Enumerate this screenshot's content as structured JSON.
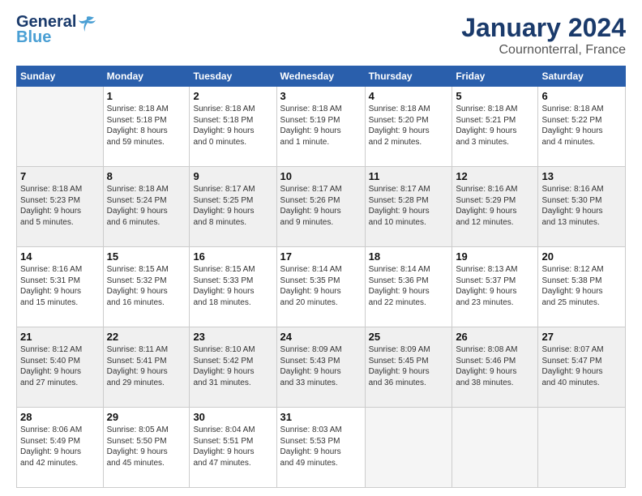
{
  "logo": {
    "text1": "General",
    "text2": "Blue"
  },
  "title": "January 2024",
  "subtitle": "Cournonterral, France",
  "weekdays": [
    "Sunday",
    "Monday",
    "Tuesday",
    "Wednesday",
    "Thursday",
    "Friday",
    "Saturday"
  ],
  "rows": [
    [
      {
        "day": "",
        "info": ""
      },
      {
        "day": "1",
        "info": "Sunrise: 8:18 AM\nSunset: 5:18 PM\nDaylight: 8 hours\nand 59 minutes."
      },
      {
        "day": "2",
        "info": "Sunrise: 8:18 AM\nSunset: 5:18 PM\nDaylight: 9 hours\nand 0 minutes."
      },
      {
        "day": "3",
        "info": "Sunrise: 8:18 AM\nSunset: 5:19 PM\nDaylight: 9 hours\nand 1 minute."
      },
      {
        "day": "4",
        "info": "Sunrise: 8:18 AM\nSunset: 5:20 PM\nDaylight: 9 hours\nand 2 minutes."
      },
      {
        "day": "5",
        "info": "Sunrise: 8:18 AM\nSunset: 5:21 PM\nDaylight: 9 hours\nand 3 minutes."
      },
      {
        "day": "6",
        "info": "Sunrise: 8:18 AM\nSunset: 5:22 PM\nDaylight: 9 hours\nand 4 minutes."
      }
    ],
    [
      {
        "day": "7",
        "info": "Sunrise: 8:18 AM\nSunset: 5:23 PM\nDaylight: 9 hours\nand 5 minutes."
      },
      {
        "day": "8",
        "info": "Sunrise: 8:18 AM\nSunset: 5:24 PM\nDaylight: 9 hours\nand 6 minutes."
      },
      {
        "day": "9",
        "info": "Sunrise: 8:17 AM\nSunset: 5:25 PM\nDaylight: 9 hours\nand 8 minutes."
      },
      {
        "day": "10",
        "info": "Sunrise: 8:17 AM\nSunset: 5:26 PM\nDaylight: 9 hours\nand 9 minutes."
      },
      {
        "day": "11",
        "info": "Sunrise: 8:17 AM\nSunset: 5:28 PM\nDaylight: 9 hours\nand 10 minutes."
      },
      {
        "day": "12",
        "info": "Sunrise: 8:16 AM\nSunset: 5:29 PM\nDaylight: 9 hours\nand 12 minutes."
      },
      {
        "day": "13",
        "info": "Sunrise: 8:16 AM\nSunset: 5:30 PM\nDaylight: 9 hours\nand 13 minutes."
      }
    ],
    [
      {
        "day": "14",
        "info": "Sunrise: 8:16 AM\nSunset: 5:31 PM\nDaylight: 9 hours\nand 15 minutes."
      },
      {
        "day": "15",
        "info": "Sunrise: 8:15 AM\nSunset: 5:32 PM\nDaylight: 9 hours\nand 16 minutes."
      },
      {
        "day": "16",
        "info": "Sunrise: 8:15 AM\nSunset: 5:33 PM\nDaylight: 9 hours\nand 18 minutes."
      },
      {
        "day": "17",
        "info": "Sunrise: 8:14 AM\nSunset: 5:35 PM\nDaylight: 9 hours\nand 20 minutes."
      },
      {
        "day": "18",
        "info": "Sunrise: 8:14 AM\nSunset: 5:36 PM\nDaylight: 9 hours\nand 22 minutes."
      },
      {
        "day": "19",
        "info": "Sunrise: 8:13 AM\nSunset: 5:37 PM\nDaylight: 9 hours\nand 23 minutes."
      },
      {
        "day": "20",
        "info": "Sunrise: 8:12 AM\nSunset: 5:38 PM\nDaylight: 9 hours\nand 25 minutes."
      }
    ],
    [
      {
        "day": "21",
        "info": "Sunrise: 8:12 AM\nSunset: 5:40 PM\nDaylight: 9 hours\nand 27 minutes."
      },
      {
        "day": "22",
        "info": "Sunrise: 8:11 AM\nSunset: 5:41 PM\nDaylight: 9 hours\nand 29 minutes."
      },
      {
        "day": "23",
        "info": "Sunrise: 8:10 AM\nSunset: 5:42 PM\nDaylight: 9 hours\nand 31 minutes."
      },
      {
        "day": "24",
        "info": "Sunrise: 8:09 AM\nSunset: 5:43 PM\nDaylight: 9 hours\nand 33 minutes."
      },
      {
        "day": "25",
        "info": "Sunrise: 8:09 AM\nSunset: 5:45 PM\nDaylight: 9 hours\nand 36 minutes."
      },
      {
        "day": "26",
        "info": "Sunrise: 8:08 AM\nSunset: 5:46 PM\nDaylight: 9 hours\nand 38 minutes."
      },
      {
        "day": "27",
        "info": "Sunrise: 8:07 AM\nSunset: 5:47 PM\nDaylight: 9 hours\nand 40 minutes."
      }
    ],
    [
      {
        "day": "28",
        "info": "Sunrise: 8:06 AM\nSunset: 5:49 PM\nDaylight: 9 hours\nand 42 minutes."
      },
      {
        "day": "29",
        "info": "Sunrise: 8:05 AM\nSunset: 5:50 PM\nDaylight: 9 hours\nand 45 minutes."
      },
      {
        "day": "30",
        "info": "Sunrise: 8:04 AM\nSunset: 5:51 PM\nDaylight: 9 hours\nand 47 minutes."
      },
      {
        "day": "31",
        "info": "Sunrise: 8:03 AM\nSunset: 5:53 PM\nDaylight: 9 hours\nand 49 minutes."
      },
      {
        "day": "",
        "info": ""
      },
      {
        "day": "",
        "info": ""
      },
      {
        "day": "",
        "info": ""
      }
    ]
  ]
}
